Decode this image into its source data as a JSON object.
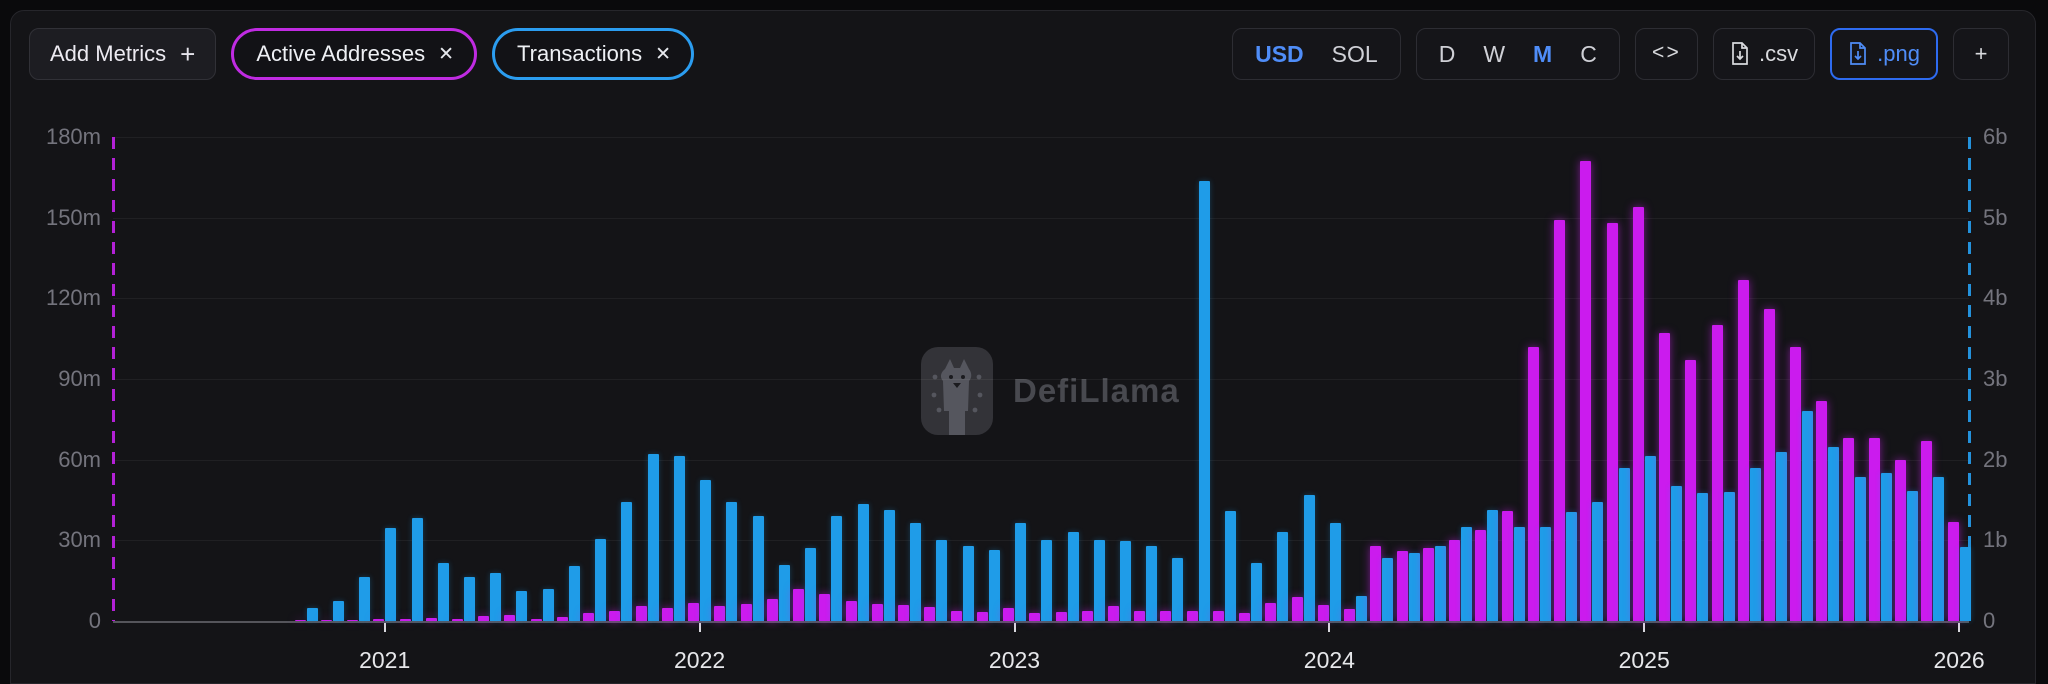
{
  "header": {
    "add_metrics_label": "Add Metrics",
    "add_metrics_plus": "+",
    "pills": [
      {
        "label": "Active Addresses",
        "close": "✕",
        "color": "#c02be2"
      },
      {
        "label": "Transactions",
        "close": "✕",
        "color": "#2b9df0"
      }
    ],
    "currency_toggle": {
      "options": [
        "USD",
        "SOL"
      ],
      "selected": "USD"
    },
    "interval_toggle": {
      "options": [
        "D",
        "W",
        "M",
        "C"
      ],
      "selected": "M"
    },
    "code_button_label": "<>",
    "csv_button_label": ".csv",
    "png_button_label": ".png",
    "add_chart_button_label": "+"
  },
  "watermark_text": "DefiLlama",
  "chart_data": {
    "type": "bar",
    "start_month": "2020-10",
    "months_count": 64,
    "x_tick_labels": [
      "2021",
      "2022",
      "2023",
      "2024",
      "2025",
      "2026"
    ],
    "x_tick_month_indices": [
      3,
      15,
      27,
      39,
      51,
      63
    ],
    "left_axis": {
      "title": "Active Addresses",
      "unit": "millions",
      "ticks": [
        "0",
        "30m",
        "60m",
        "90m",
        "120m",
        "150m",
        "180m"
      ],
      "max": 180
    },
    "right_axis": {
      "title": "Transactions",
      "unit": "billions",
      "ticks": [
        "0",
        "1b",
        "2b",
        "3b",
        "4b",
        "5b",
        "6b"
      ],
      "max": 6
    },
    "grid": true,
    "series": [
      {
        "name": "Active Addresses",
        "axis": "left",
        "color": "#cb1bee",
        "unit_suffix": "m",
        "values_millions": [
          0.2,
          0.3,
          0.5,
          0.6,
          0.8,
          1.0,
          0.8,
          1.9,
          2.2,
          0.8,
          1.5,
          3.0,
          3.7,
          5.5,
          5.0,
          6.7,
          5.6,
          6.3,
          8.1,
          11.9,
          10.0,
          7.4,
          6.3,
          5.9,
          5.2,
          3.7,
          3.3,
          4.8,
          3.0,
          3.3,
          3.7,
          5.6,
          3.7,
          3.7,
          3.7,
          3.7,
          3.0,
          6.7,
          8.9,
          6.0,
          4.4,
          28,
          26,
          27,
          30,
          34,
          41,
          102,
          149,
          171,
          148,
          154,
          107,
          97,
          110,
          127,
          116,
          102,
          82,
          68,
          68,
          60,
          67,
          37
        ]
      },
      {
        "name": "Transactions",
        "axis": "right",
        "color": "#1f9ce8",
        "unit_suffix": "b",
        "values_billions": [
          0.16,
          0.25,
          0.55,
          1.15,
          1.28,
          0.72,
          0.55,
          0.6,
          0.37,
          0.4,
          0.68,
          1.02,
          1.48,
          2.07,
          2.05,
          1.75,
          1.48,
          1.3,
          0.7,
          0.91,
          1.3,
          1.45,
          1.38,
          1.21,
          1.01,
          0.93,
          0.88,
          1.22,
          1.0,
          1.11,
          1.01,
          0.99,
          0.93,
          0.78,
          5.45,
          1.36,
          0.72,
          1.11,
          1.56,
          1.21,
          0.31,
          0.78,
          0.84,
          0.93,
          1.16,
          1.38,
          1.17,
          1.16,
          1.35,
          1.48,
          1.9,
          2.05,
          1.67,
          1.59,
          1.6,
          1.9,
          2.09,
          2.6,
          2.16,
          1.78,
          1.83,
          1.61,
          1.79,
          0.92
        ]
      }
    ]
  }
}
